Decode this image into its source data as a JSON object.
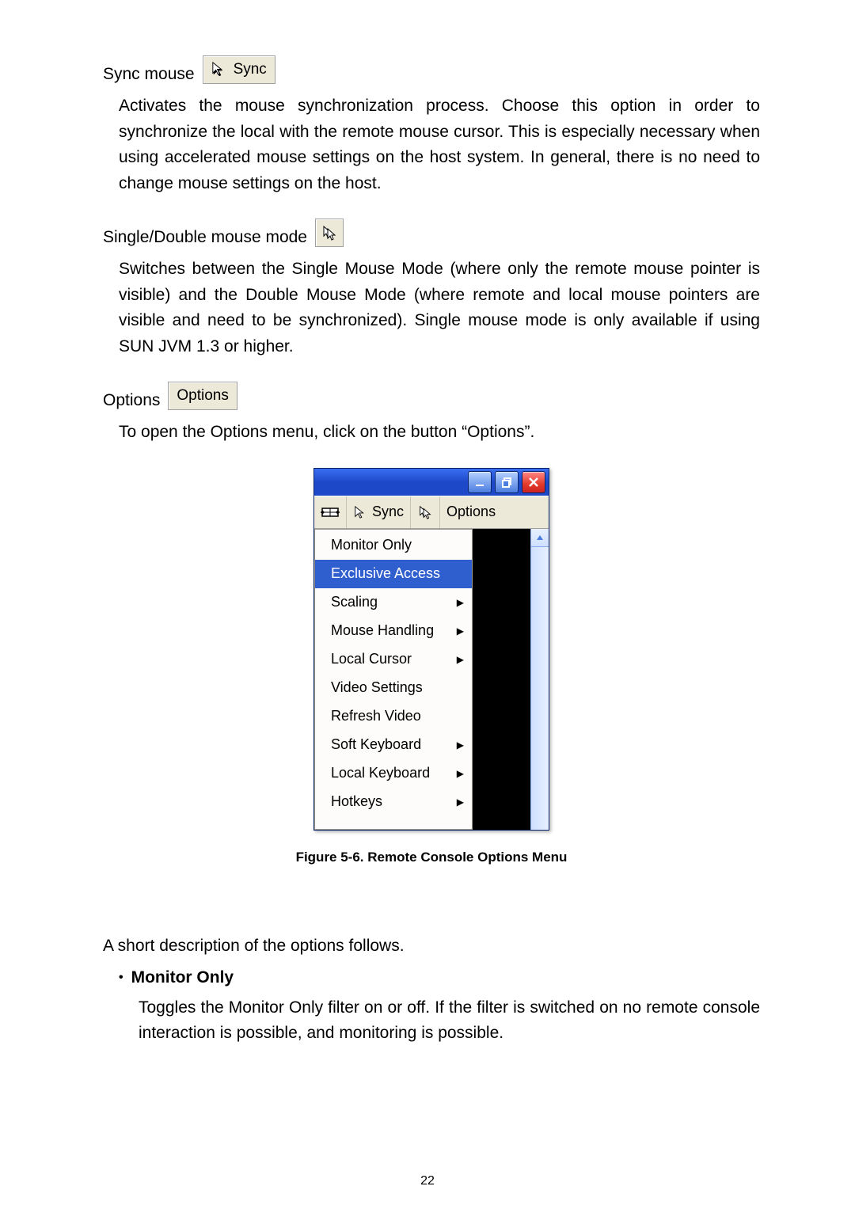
{
  "sync_mouse": {
    "label": "Sync mouse",
    "button_label": "Sync",
    "desc": "Activates the mouse synchronization process. Choose this option in order to synchronize the local with the remote mouse cursor. This is especially necessary when using accelerated mouse settings on the host system. In general, there is no need to change mouse settings on the host."
  },
  "mouse_mode": {
    "label": "Single/Double mouse mode",
    "desc": "Switches between the Single Mouse Mode (where only the remote mouse pointer is visible) and the Double Mouse Mode (where remote and local mouse pointers are visible and need to be synchronized). Single mouse mode is only available if using SUN JVM 1.3 or higher."
  },
  "options": {
    "label": "Options",
    "button_label": "Options",
    "desc": "To open the Options menu, click on the button “Options”."
  },
  "figure": {
    "toolbar_sync": "Sync",
    "toolbar_options": "Options",
    "menu": {
      "items": [
        {
          "label": "Monitor Only",
          "submenu": false,
          "selected": false
        },
        {
          "label": "Exclusive Access",
          "submenu": false,
          "selected": true
        },
        {
          "label": "Scaling",
          "submenu": true,
          "selected": false
        },
        {
          "label": "Mouse Handling",
          "submenu": true,
          "selected": false
        },
        {
          "label": "Local Cursor",
          "submenu": true,
          "selected": false
        },
        {
          "label": "Video Settings",
          "submenu": false,
          "selected": false
        },
        {
          "label": "Refresh Video",
          "submenu": false,
          "selected": false
        },
        {
          "label": "Soft Keyboard",
          "submenu": true,
          "selected": false
        },
        {
          "label": "Local Keyboard",
          "submenu": true,
          "selected": false
        },
        {
          "label": "Hotkeys",
          "submenu": true,
          "selected": false
        }
      ]
    },
    "caption": "Figure 5-6. Remote Console Options Menu"
  },
  "follows_text": "A short description of the options follows.",
  "monitor_only": {
    "heading": "Monitor Only",
    "desc": "Toggles the Monitor Only filter on or off. If the filter is switched on no remote console interaction is possible, and monitoring is possible."
  },
  "page_number": "22"
}
